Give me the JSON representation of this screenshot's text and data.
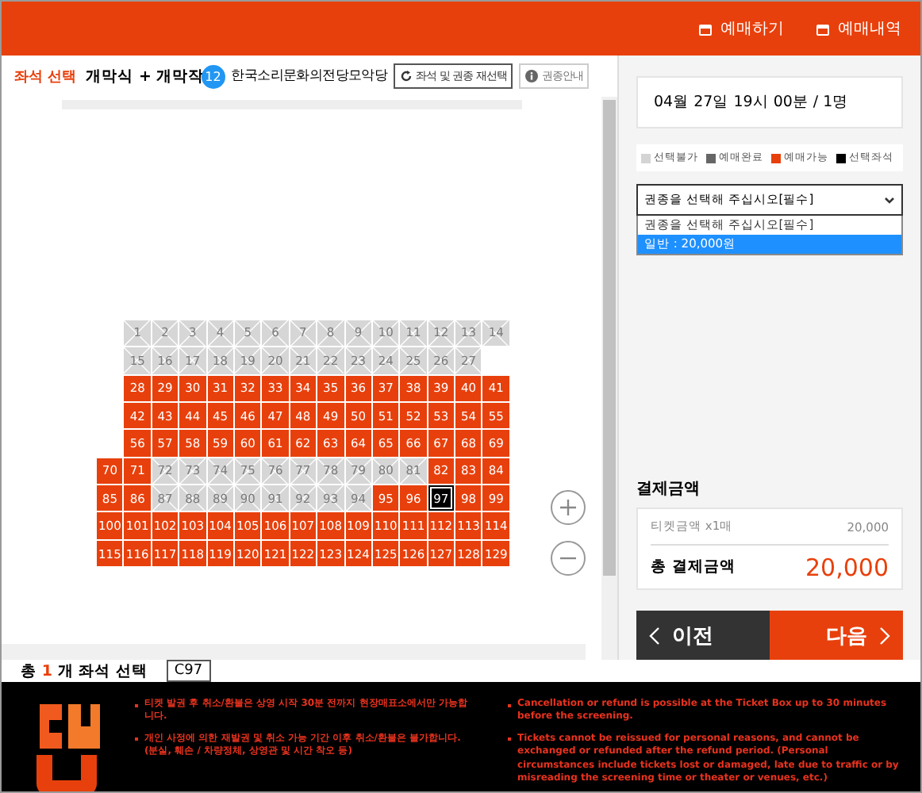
{
  "top_nav": [
    {
      "label": "예매하기"
    },
    {
      "label": "예매내역"
    }
  ],
  "header": {
    "section": "좌석 선택",
    "title": "개막식 + 개막작",
    "age_badge": "12",
    "venue": "한국소리문화의전당모악당",
    "reselect_button": "좌석 및 권종 재선택",
    "guide_button": "권종안내"
  },
  "seat_rows": [
    {
      "indented": true,
      "seats": [
        {
          "label": "1",
          "kind": "unavailable"
        },
        {
          "label": "2",
          "kind": "unavailable"
        },
        {
          "label": "3",
          "kind": "unavailable"
        },
        {
          "label": "4",
          "kind": "unavailable"
        },
        {
          "label": "5",
          "kind": "unavailable"
        },
        {
          "label": "6",
          "kind": "unavailable"
        },
        {
          "label": "7",
          "kind": "unavailable"
        },
        {
          "label": "8",
          "kind": "unavailable"
        },
        {
          "label": "9",
          "kind": "unavailable"
        },
        {
          "label": "10",
          "kind": "unavailable"
        },
        {
          "label": "11",
          "kind": "unavailable"
        },
        {
          "label": "12",
          "kind": "unavailable"
        },
        {
          "label": "13",
          "kind": "unavailable"
        },
        {
          "label": "14",
          "kind": "unavailable"
        }
      ]
    },
    {
      "indented": true,
      "seats": [
        {
          "label": "15",
          "kind": "unavailable"
        },
        {
          "label": "16",
          "kind": "unavailable"
        },
        {
          "label": "17",
          "kind": "unavailable"
        },
        {
          "label": "18",
          "kind": "unavailable"
        },
        {
          "label": "19",
          "kind": "unavailable"
        },
        {
          "label": "20",
          "kind": "unavailable"
        },
        {
          "label": "21",
          "kind": "unavailable"
        },
        {
          "label": "22",
          "kind": "unavailable"
        },
        {
          "label": "23",
          "kind": "unavailable"
        },
        {
          "label": "24",
          "kind": "unavailable"
        },
        {
          "label": "25",
          "kind": "unavailable"
        },
        {
          "label": "26",
          "kind": "unavailable"
        },
        {
          "label": "27",
          "kind": "unavailable"
        }
      ]
    },
    {
      "indented": true,
      "seats": [
        {
          "label": "28",
          "kind": "available"
        },
        {
          "label": "29",
          "kind": "available"
        },
        {
          "label": "30",
          "kind": "available"
        },
        {
          "label": "31",
          "kind": "available"
        },
        {
          "label": "32",
          "kind": "available"
        },
        {
          "label": "33",
          "kind": "available"
        },
        {
          "label": "34",
          "kind": "available"
        },
        {
          "label": "35",
          "kind": "available"
        },
        {
          "label": "36",
          "kind": "available"
        },
        {
          "label": "37",
          "kind": "available"
        },
        {
          "label": "38",
          "kind": "available"
        },
        {
          "label": "39",
          "kind": "available"
        },
        {
          "label": "40",
          "kind": "available"
        },
        {
          "label": "41",
          "kind": "available"
        }
      ]
    },
    {
      "indented": true,
      "seats": [
        {
          "label": "42",
          "kind": "available"
        },
        {
          "label": "43",
          "kind": "available"
        },
        {
          "label": "44",
          "kind": "available"
        },
        {
          "label": "45",
          "kind": "available"
        },
        {
          "label": "46",
          "kind": "available"
        },
        {
          "label": "47",
          "kind": "available"
        },
        {
          "label": "48",
          "kind": "available"
        },
        {
          "label": "49",
          "kind": "available"
        },
        {
          "label": "50",
          "kind": "available"
        },
        {
          "label": "51",
          "kind": "available"
        },
        {
          "label": "52",
          "kind": "available"
        },
        {
          "label": "53",
          "kind": "available"
        },
        {
          "label": "54",
          "kind": "available"
        },
        {
          "label": "55",
          "kind": "available"
        }
      ]
    },
    {
      "indented": true,
      "seats": [
        {
          "label": "56",
          "kind": "available"
        },
        {
          "label": "57",
          "kind": "available"
        },
        {
          "label": "58",
          "kind": "available"
        },
        {
          "label": "59",
          "kind": "available"
        },
        {
          "label": "60",
          "kind": "available"
        },
        {
          "label": "61",
          "kind": "available"
        },
        {
          "label": "62",
          "kind": "available"
        },
        {
          "label": "63",
          "kind": "available"
        },
        {
          "label": "64",
          "kind": "available"
        },
        {
          "label": "65",
          "kind": "available"
        },
        {
          "label": "66",
          "kind": "available"
        },
        {
          "label": "67",
          "kind": "available"
        },
        {
          "label": "68",
          "kind": "available"
        },
        {
          "label": "69",
          "kind": "available"
        }
      ]
    },
    {
      "indented": false,
      "seats": [
        {
          "label": "70",
          "kind": "available"
        },
        {
          "label": "71",
          "kind": "available"
        },
        {
          "label": "72",
          "kind": "unavailable"
        },
        {
          "label": "73",
          "kind": "unavailable"
        },
        {
          "label": "74",
          "kind": "unavailable"
        },
        {
          "label": "75",
          "kind": "unavailable"
        },
        {
          "label": "76",
          "kind": "unavailable"
        },
        {
          "label": "77",
          "kind": "unavailable"
        },
        {
          "label": "78",
          "kind": "unavailable"
        },
        {
          "label": "79",
          "kind": "unavailable"
        },
        {
          "label": "80",
          "kind": "unavailable"
        },
        {
          "label": "81",
          "kind": "unavailable"
        },
        {
          "label": "82",
          "kind": "available"
        },
        {
          "label": "83",
          "kind": "available"
        },
        {
          "label": "84",
          "kind": "available"
        }
      ]
    },
    {
      "indented": false,
      "seats": [
        {
          "label": "85",
          "kind": "available"
        },
        {
          "label": "86",
          "kind": "available"
        },
        {
          "label": "87",
          "kind": "unavailable"
        },
        {
          "label": "88",
          "kind": "unavailable"
        },
        {
          "label": "89",
          "kind": "unavailable"
        },
        {
          "label": "90",
          "kind": "unavailable"
        },
        {
          "label": "91",
          "kind": "unavailable"
        },
        {
          "label": "92",
          "kind": "unavailable"
        },
        {
          "label": "93",
          "kind": "unavailable"
        },
        {
          "label": "94",
          "kind": "unavailable"
        },
        {
          "label": "95",
          "kind": "available"
        },
        {
          "label": "96",
          "kind": "available"
        },
        {
          "label": "97",
          "kind": "selected"
        },
        {
          "label": "98",
          "kind": "available"
        },
        {
          "label": "99",
          "kind": "available"
        }
      ]
    },
    {
      "indented": false,
      "seats": [
        {
          "label": "100",
          "kind": "available"
        },
        {
          "label": "101",
          "kind": "available"
        },
        {
          "label": "102",
          "kind": "available"
        },
        {
          "label": "103",
          "kind": "available"
        },
        {
          "label": "104",
          "kind": "available"
        },
        {
          "label": "105",
          "kind": "available"
        },
        {
          "label": "106",
          "kind": "available"
        },
        {
          "label": "107",
          "kind": "available"
        },
        {
          "label": "108",
          "kind": "available"
        },
        {
          "label": "109",
          "kind": "available"
        },
        {
          "label": "110",
          "kind": "available"
        },
        {
          "label": "111",
          "kind": "available"
        },
        {
          "label": "112",
          "kind": "available"
        },
        {
          "label": "113",
          "kind": "available"
        },
        {
          "label": "114",
          "kind": "available"
        }
      ]
    },
    {
      "indented": false,
      "seats": [
        {
          "label": "115",
          "kind": "available"
        },
        {
          "label": "116",
          "kind": "available"
        },
        {
          "label": "117",
          "kind": "available"
        },
        {
          "label": "118",
          "kind": "available"
        },
        {
          "label": "119",
          "kind": "available"
        },
        {
          "label": "120",
          "kind": "available"
        },
        {
          "label": "121",
          "kind": "available"
        },
        {
          "label": "122",
          "kind": "available"
        },
        {
          "label": "123",
          "kind": "available"
        },
        {
          "label": "124",
          "kind": "available"
        },
        {
          "label": "125",
          "kind": "available"
        },
        {
          "label": "126",
          "kind": "available"
        },
        {
          "label": "127",
          "kind": "available"
        },
        {
          "label": "128",
          "kind": "available"
        },
        {
          "label": "129",
          "kind": "available"
        }
      ]
    }
  ],
  "selection_summary": {
    "prefix": "총",
    "count": "1",
    "suffix": "개 좌석 선택",
    "seat": "C97"
  },
  "booking": {
    "datetime": "04월 27일 19시 00분 / 1명",
    "legend": [
      {
        "label": "선택불가",
        "color": "#d4d4d4"
      },
      {
        "label": "예매완료",
        "color": "#666666"
      },
      {
        "label": "예매가능",
        "color": "#e8400c"
      },
      {
        "label": "선택좌석",
        "color": "#000000"
      }
    ],
    "ticket_select": {
      "value": "권종을 선택해 주십시오[필수]",
      "options": [
        {
          "label": "권종을 선택해 주십시오[필수]",
          "highlighted": false
        },
        {
          "label": "일반 : 20,000원",
          "highlighted": true
        }
      ]
    },
    "payment_title": "결제금액",
    "ticket_line": "티켓금액 x1매",
    "ticket_amount": "20,000",
    "total_label": "총 결제금액",
    "total_amount": "20,000",
    "prev_button": "이전",
    "next_button": "다음"
  },
  "notices": {
    "korean": [
      "티켓 발권 후 취소/환불은 상영 시작 30분 전까지 현장매표소에서만 가능합니다.",
      "개인 사정에 의한 재발권 및 취소 가능 기간 이후 취소/환불은 불가합니다. (분실, 훼손 / 차량정체, 상영관 및 시간 착오 등)"
    ],
    "english": [
      "Cancellation or refund is possible at the Ticket Box up to 30 minutes before the screening.",
      "Tickets cannot be reissued for personal reasons, and cannot be exchanged or refunded after the refund period. (Personal circumstances include tickets lost or damaged, late due to traffic or by misreading the screening time or theater or venues, etc.)"
    ]
  }
}
